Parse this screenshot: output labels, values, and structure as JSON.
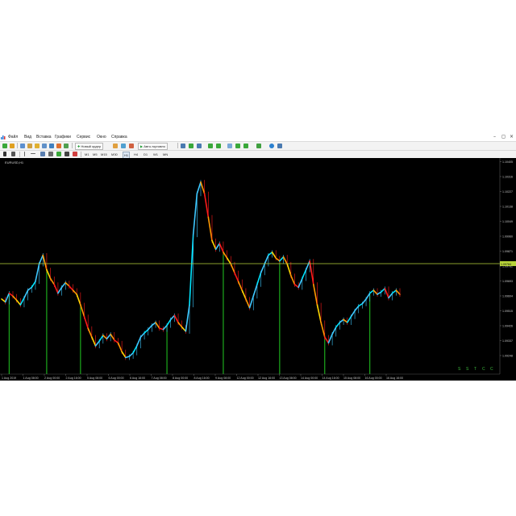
{
  "menubar": {
    "items": [
      "Файл",
      "Вид",
      "Вставка",
      "Графики",
      "Сервис",
      "Окно",
      "Справка"
    ],
    "window_buttons": [
      "–",
      "◻",
      "×"
    ]
  },
  "toolbar": {
    "new_order_label": "Новый ордер",
    "autotrading_label": "Авто-торговля",
    "timeframes": [
      "M1",
      "M5",
      "M15",
      "M30",
      "H1",
      "H4",
      "D1",
      "W1",
      "MN"
    ]
  },
  "chart": {
    "symbol_label": "EURUSD,H1",
    "current_price": "1.09784",
    "price_axis": [
      "1.10405",
      "1.10316",
      "1.10227",
      "1.10138",
      "1.10049",
      "1.09960",
      "1.09871",
      "1.09782",
      "1.09693",
      "1.09604",
      "1.09515",
      "1.09426",
      "1.09337",
      "1.09248"
    ],
    "time_axis": [
      "1 Aug 2019",
      "1 Aug 08:00",
      "2 Aug 00:00",
      "2 Aug 16:00",
      "5 Aug 08:00",
      "6 Aug 00:00",
      "6 Aug 16:00",
      "7 Aug 08:00",
      "8 Aug 00:00",
      "8 Aug 16:00",
      "9 Aug 08:00",
      "12 Aug 00:00",
      "12 Aug 16:00",
      "13 Aug 08:00",
      "14 Aug 00:00",
      "14 Aug 16:00",
      "15 Aug 08:00",
      "16 Aug 00:00",
      "16 Aug 16:00"
    ],
    "status_symbols": [
      "S",
      "S",
      "T",
      "C",
      "C"
    ]
  },
  "colors": {
    "up": "#3ec8ff",
    "up_strong": "#00e5ff",
    "down_a": "#ff9900",
    "down_b": "#ffd700",
    "down_c": "#ff1a1a",
    "signal_line": "#22cc22",
    "price_line": "#b8d43a"
  },
  "chart_data": {
    "type": "line",
    "closes": [
      1.097,
      1.0965,
      1.098,
      1.0975,
      1.0968,
      1.096,
      1.0972,
      1.0985,
      1.099,
      1.1,
      1.103,
      1.1045,
      1.102,
      1.1005,
      1.0995,
      1.098,
      1.099,
      1.0998,
      1.0992,
      1.0985,
      1.0978,
      1.096,
      1.094,
      1.092,
      1.0905,
      1.089,
      1.0898,
      1.0908,
      1.0902,
      1.091,
      1.09,
      1.0895,
      1.088,
      1.087,
      1.0872,
      1.0878,
      1.089,
      1.0905,
      1.0912,
      1.0918,
      1.0925,
      1.093,
      1.092,
      1.0918,
      1.0925,
      1.0935,
      1.0942,
      1.093,
      1.0922,
      1.0915,
      1.096,
      1.108,
      1.115,
      1.117,
      1.115,
      1.111,
      1.107,
      1.1055,
      1.1065,
      1.105,
      1.104,
      1.103,
      1.1015,
      1.1,
      1.0985,
      1.097,
      1.0955,
      1.0975,
      1.0995,
      1.1015,
      1.103,
      1.1045,
      1.105,
      1.104,
      1.1035,
      1.1042,
      1.103,
      1.101,
      1.0995,
      1.099,
      1.1005,
      1.102,
      1.1035,
      1.0995,
      1.096,
      1.093,
      1.0905,
      1.0895,
      1.091,
      1.0922,
      1.093,
      1.0935,
      1.093,
      1.094,
      1.095,
      1.0958,
      1.0962,
      1.097,
      1.098,
      1.0985,
      1.0978,
      1.0982,
      1.0988,
      1.0972,
      1.098,
      1.0985,
      1.0978
    ]
  }
}
